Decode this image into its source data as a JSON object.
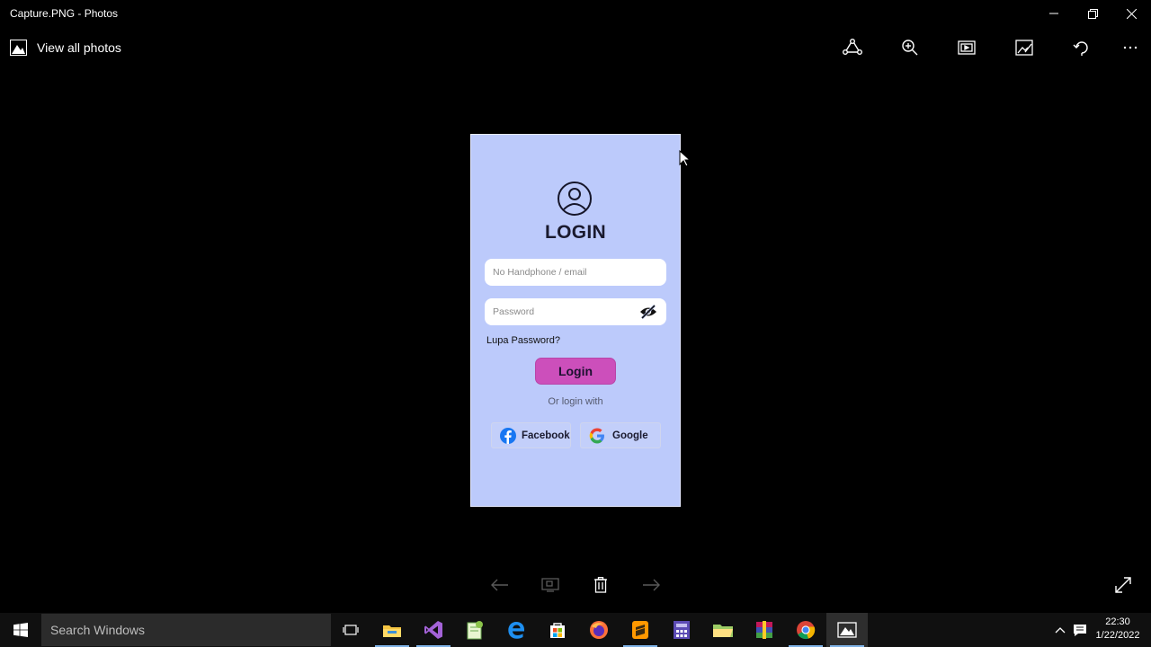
{
  "window": {
    "title": "Capture.PNG - Photos"
  },
  "appbar": {
    "view_all_label": "View all photos",
    "tools": [
      "share-icon",
      "zoom-icon",
      "slideshow-icon",
      "edit-icon",
      "rotate-icon",
      "more-icon"
    ]
  },
  "photo": {
    "heading": "LOGIN",
    "phone_placeholder": "No Handphone / email",
    "password_placeholder": "Password",
    "forgot_label": "Lupa Password?",
    "login_label": "Login",
    "or_label": "Or login with",
    "facebook_label": "Facebook",
    "google_label": "Google",
    "colors": {
      "background": "#bccafb",
      "login_button": "#cc4fbb",
      "facebook": "#1877f2"
    }
  },
  "taskbar": {
    "search_placeholder": "Search Windows",
    "apps": [
      "task-view-icon",
      "file-explorer-icon",
      "visual-studio-icon",
      "notepad-icon",
      "edge-icon",
      "store-icon",
      "firefox-icon",
      "sublime-icon",
      "calculator-icon",
      "folder-icon",
      "winrar-icon",
      "chrome-icon",
      "photos-icon"
    ],
    "time": "22:30",
    "date": "1/22/2022"
  }
}
